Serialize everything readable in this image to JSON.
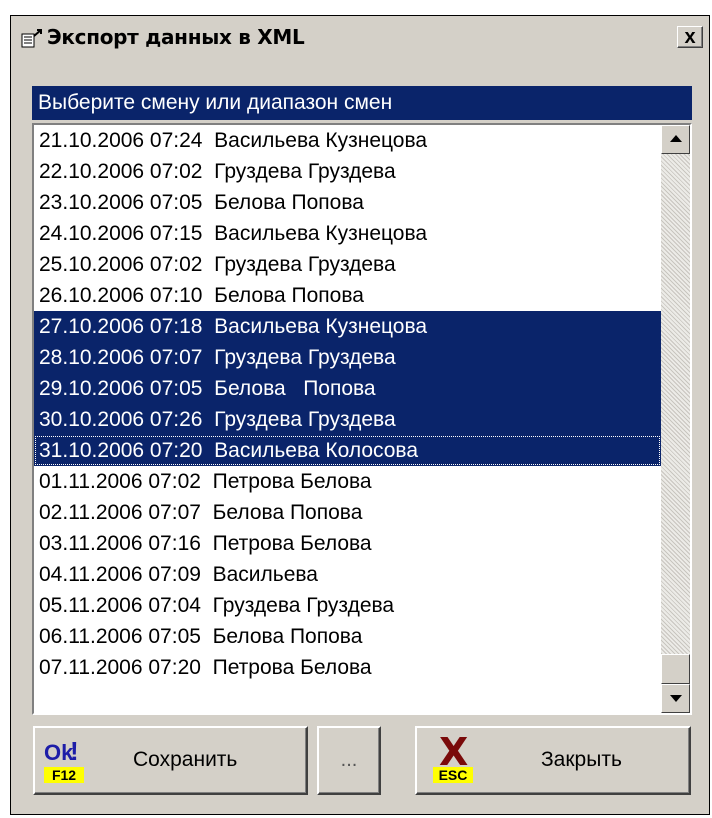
{
  "window": {
    "title": "Экспорт данных в XML",
    "close_symbol": "x"
  },
  "header": {
    "prompt": "Выберите смену или диапазон смен"
  },
  "list": {
    "items": [
      {
        "text": "21.10.2006 07:24  Васильева Кузнецова",
        "selected": false
      },
      {
        "text": "22.10.2006 07:02  Груздева Груздева",
        "selected": false
      },
      {
        "text": "23.10.2006 07:05  Белова Попова",
        "selected": false
      },
      {
        "text": "24.10.2006 07:15  Васильева Кузнецова",
        "selected": false
      },
      {
        "text": "25.10.2006 07:02  Груздева Груздева",
        "selected": false
      },
      {
        "text": "26.10.2006 07:10  Белова Попова",
        "selected": false
      },
      {
        "text": "27.10.2006 07:18  Васильева Кузнецова",
        "selected": true
      },
      {
        "text": "28.10.2006 07:07  Груздева Груздева",
        "selected": true
      },
      {
        "text": "29.10.2006 07:05  Белова   Попова",
        "selected": true
      },
      {
        "text": "30.10.2006 07:26  Груздева Груздева",
        "selected": true
      },
      {
        "text": "31.10.2006 07:20  Васильева Колосова",
        "selected": true,
        "focused": true
      },
      {
        "text": "01.11.2006 07:02  Петрова Белова",
        "selected": false
      },
      {
        "text": "02.11.2006 07:07  Белова Попова",
        "selected": false
      },
      {
        "text": "03.11.2006 07:16  Петрова Белова",
        "selected": false
      },
      {
        "text": "04.11.2006 07:09  Васильева",
        "selected": false
      },
      {
        "text": "05.11.2006 07:04  Груздева Груздева",
        "selected": false
      },
      {
        "text": "06.11.2006 07:05  Белова Попова",
        "selected": false
      },
      {
        "text": "07.11.2006 07:20  Петрова Белова",
        "selected": false
      }
    ]
  },
  "buttons": {
    "save_icon_text": "Ok",
    "save_icon_mark": "!",
    "save_key": "F12",
    "save_label": "Сохранить",
    "dots_label": "...",
    "close_icon_mark": "X",
    "close_key": "ESC",
    "close_label": "Закрыть"
  },
  "colors": {
    "selection": "#0a246a",
    "key_badge": "#ffff00",
    "face": "#d4d0c8"
  }
}
